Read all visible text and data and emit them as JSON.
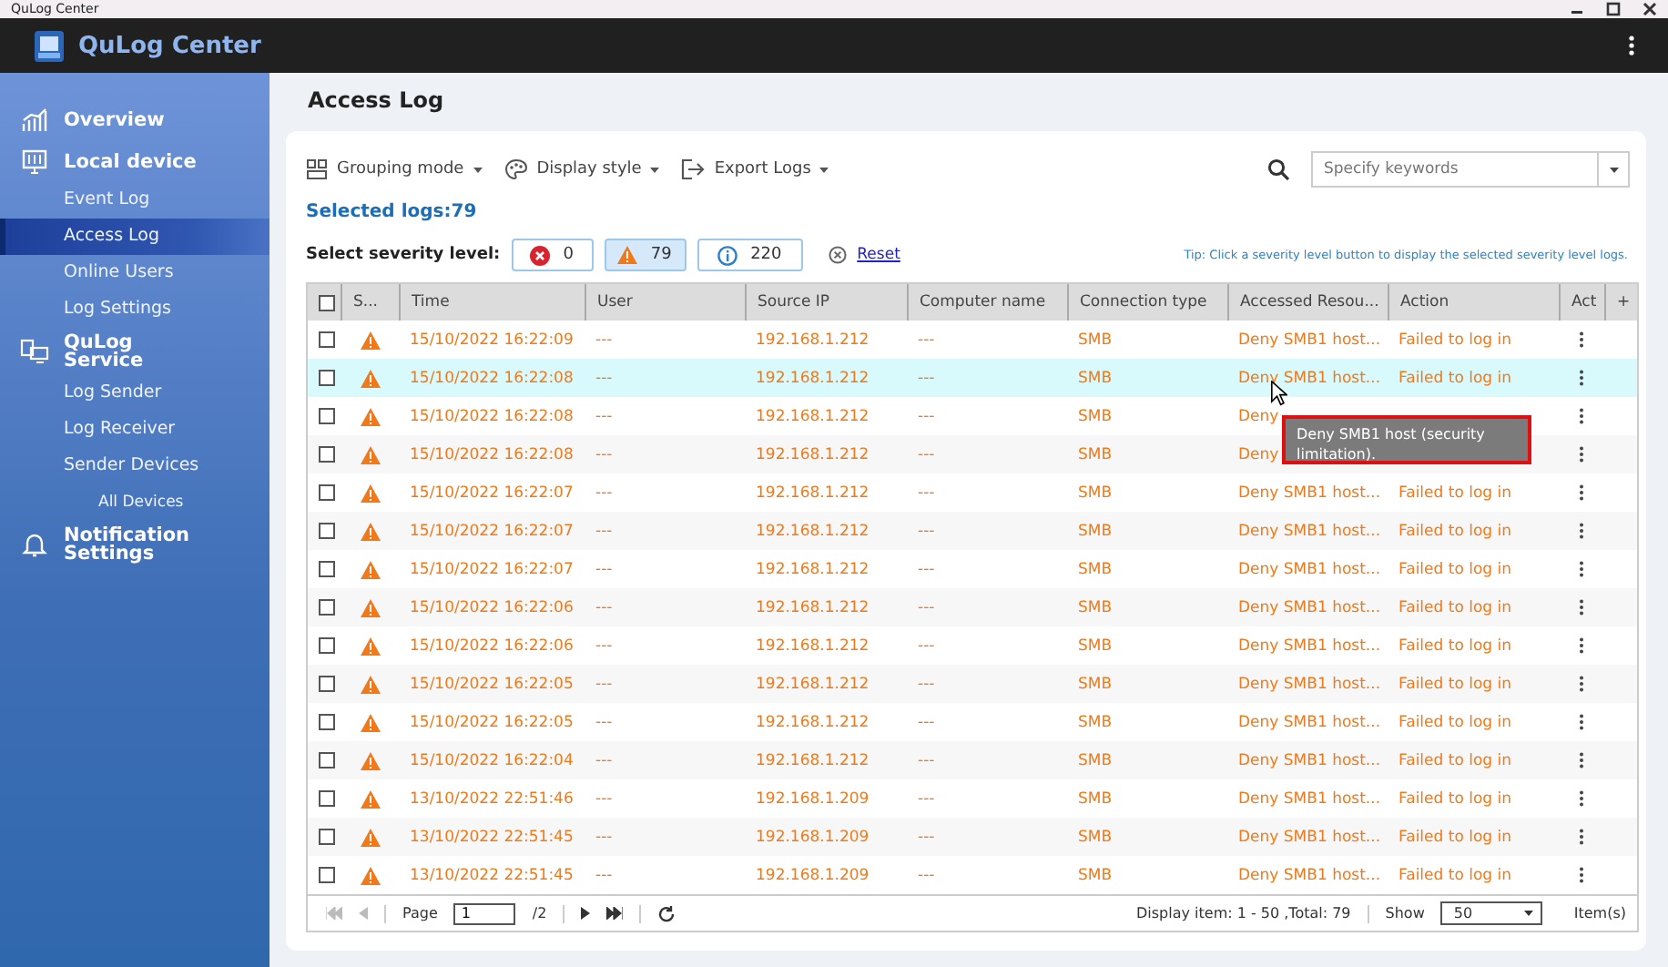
{
  "window": {
    "title": "QuLog Center"
  },
  "app": {
    "title": "QuLog Center"
  },
  "sidebar": {
    "sections": [
      {
        "label": "Overview"
      },
      {
        "label": "Local device",
        "items": [
          {
            "label": "Event Log",
            "selected": false
          },
          {
            "label": "Access Log",
            "selected": true
          },
          {
            "label": "Online Users",
            "selected": false
          },
          {
            "label": "Log Settings",
            "selected": false
          }
        ]
      },
      {
        "label": "QuLog Service",
        "items": [
          {
            "label": "Log Sender",
            "selected": false
          },
          {
            "label": "Log Receiver",
            "selected": false
          },
          {
            "label": "Sender Devices",
            "selected": false,
            "children": [
              {
                "label": "All Devices",
                "selected": false
              }
            ]
          }
        ]
      },
      {
        "label": "Notification Settings"
      }
    ]
  },
  "page": {
    "title": "Access Log"
  },
  "toolbar": {
    "menus": [
      "Grouping mode",
      "Display style",
      "Export Logs"
    ],
    "search": {
      "placeholder": "Specify keywords"
    }
  },
  "selected_logs": "Selected logs:79",
  "severity": {
    "label": "Select severity level:",
    "buttons": [
      {
        "kind": "error",
        "count": "0",
        "selected": false
      },
      {
        "kind": "warning",
        "count": "79",
        "selected": true
      },
      {
        "kind": "info",
        "count": "220",
        "selected": false
      }
    ],
    "reset": "Reset",
    "tip": "Tip: Click a severity level button to display the selected severity level logs."
  },
  "table": {
    "select_all": false,
    "columns": [
      "S...",
      "Time",
      "User",
      "Source IP",
      "Computer name",
      "Connection type",
      "Accessed Resou...",
      "Action",
      "Act",
      "+"
    ],
    "rows": [
      {
        "checked": false,
        "time": "15/10/2022 16:22:09",
        "user": "---",
        "ip": "192.168.1.212",
        "computer": "---",
        "conn": "SMB",
        "resource": "Deny SMB1 host...",
        "action": "Failed to log in",
        "hovered": false
      },
      {
        "checked": false,
        "time": "15/10/2022 16:22:08",
        "user": "---",
        "ip": "192.168.1.212",
        "computer": "---",
        "conn": "SMB",
        "resource": "Deny SMB1 host...",
        "action": "Failed to log in",
        "hovered": true
      },
      {
        "checked": false,
        "time": "15/10/2022 16:22:08",
        "user": "---",
        "ip": "192.168.1.212",
        "computer": "---",
        "conn": "SMB",
        "resource": "Deny",
        "hovered": false
      },
      {
        "checked": false,
        "time": "15/10/2022 16:22:08",
        "user": "---",
        "ip": "192.168.1.212",
        "computer": "---",
        "conn": "SMB",
        "resource": "Deny",
        "hovered": false
      },
      {
        "checked": false,
        "time": "15/10/2022 16:22:07",
        "user": "---",
        "ip": "192.168.1.212",
        "computer": "---",
        "conn": "SMB",
        "resource": "Deny SMB1 host...",
        "action": "Failed to log in",
        "hovered": false
      },
      {
        "checked": false,
        "time": "15/10/2022 16:22:07",
        "user": "---",
        "ip": "192.168.1.212",
        "computer": "---",
        "conn": "SMB",
        "resource": "Deny SMB1 host...",
        "action": "Failed to log in",
        "hovered": false
      },
      {
        "checked": false,
        "time": "15/10/2022 16:22:07",
        "user": "---",
        "ip": "192.168.1.212",
        "computer": "---",
        "conn": "SMB",
        "resource": "Deny SMB1 host...",
        "action": "Failed to log in",
        "hovered": false
      },
      {
        "checked": false,
        "time": "15/10/2022 16:22:06",
        "user": "---",
        "ip": "192.168.1.212",
        "computer": "---",
        "conn": "SMB",
        "resource": "Deny SMB1 host...",
        "action": "Failed to log in",
        "hovered": false
      },
      {
        "checked": false,
        "time": "15/10/2022 16:22:06",
        "user": "---",
        "ip": "192.168.1.212",
        "computer": "---",
        "conn": "SMB",
        "resource": "Deny SMB1 host...",
        "action": "Failed to log in",
        "hovered": false
      },
      {
        "checked": false,
        "time": "15/10/2022 16:22:05",
        "user": "---",
        "ip": "192.168.1.212",
        "computer": "---",
        "conn": "SMB",
        "resource": "Deny SMB1 host...",
        "action": "Failed to log in",
        "hovered": false
      },
      {
        "checked": false,
        "time": "15/10/2022 16:22:05",
        "user": "---",
        "ip": "192.168.1.212",
        "computer": "---",
        "conn": "SMB",
        "resource": "Deny SMB1 host...",
        "action": "Failed to log in",
        "hovered": false
      },
      {
        "checked": false,
        "time": "15/10/2022 16:22:04",
        "user": "---",
        "ip": "192.168.1.212",
        "computer": "---",
        "conn": "SMB",
        "resource": "Deny SMB1 host...",
        "action": "Failed to log in",
        "hovered": false
      },
      {
        "checked": false,
        "time": "13/10/2022 22:51:46",
        "user": "---",
        "ip": "192.168.1.209",
        "computer": "---",
        "conn": "SMB",
        "resource": "Deny SMB1 host...",
        "action": "Failed to log in",
        "hovered": false
      },
      {
        "checked": false,
        "time": "13/10/2022 22:51:45",
        "user": "---",
        "ip": "192.168.1.209",
        "computer": "---",
        "conn": "SMB",
        "resource": "Deny SMB1 host...",
        "action": "Failed to log in",
        "hovered": false
      },
      {
        "checked": false,
        "time": "13/10/2022 22:51:45",
        "user": "---",
        "ip": "192.168.1.209",
        "computer": "---",
        "conn": "SMB",
        "resource": "Deny SMB1 host...",
        "action": "Failed to log in",
        "hovered": false
      }
    ]
  },
  "tooltip": "Deny SMB1 host (security limitation).",
  "pager": {
    "page_label": "Page",
    "page": "1",
    "of": "/2",
    "display": "Display item: 1 - 50 ,Total: 79",
    "show": "Show",
    "per_page": "50",
    "items": "Item(s)"
  }
}
